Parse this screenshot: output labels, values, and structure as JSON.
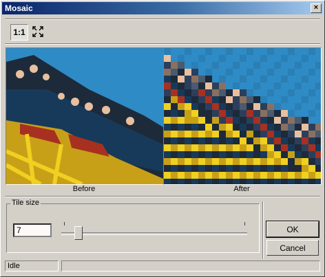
{
  "window": {
    "title": "Mosaic",
    "close_glyph": "×"
  },
  "toolbar": {
    "actual_size_label": "1:1",
    "fit_icon": "fit-to-window-icon"
  },
  "preview": {
    "before_label": "Before",
    "after_label": "After"
  },
  "tile_size": {
    "group_label": "Tile size",
    "value": "7",
    "slider_fraction": 0.08
  },
  "buttons": {
    "ok_label": "OK",
    "cancel_label": "Cancel"
  },
  "status": {
    "text": "Idle",
    "secondary": ""
  },
  "colors": {
    "title_start": "#0a246a",
    "title_end": "#a6caf0",
    "sky": "#2e8bc5",
    "face": "#d4d0c8"
  }
}
